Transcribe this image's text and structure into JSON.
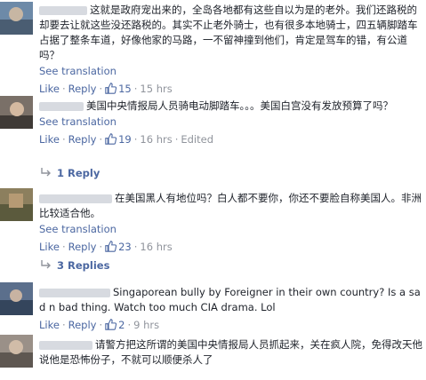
{
  "colors": {
    "link": "#4b67a1",
    "meta": "#90949c",
    "text": "#1d2129"
  },
  "comments": [
    {
      "text": "这就是政府宠出来的，全岛各地都有这些自以为是的老外。我们还路税的却要去让就这些没还路税的。其实不止老外骑士，也有很多本地骑士，四五辆脚踏车占据了整条车道，好像他家的马路，一不留神撞到他们，肯定是驾车的错，有公道吗？",
      "see_translation": "See translation",
      "like": "Like",
      "reply": "Reply",
      "like_count": "15",
      "time": "15 hrs",
      "edited": ""
    },
    {
      "text": "美国中央情报局人员骑电动脚踏车。。。美国白宫没有发放预算了吗？",
      "see_translation": "See translation",
      "like": "Like",
      "reply": "Reply",
      "like_count": "19",
      "time": "16 hrs",
      "edited": "Edited"
    },
    {
      "text": "在美国黑人有地位吗？白人都不要你，你还不要脸自称美国人。非洲比较适合他。",
      "see_translation": "See translation",
      "like": "Like",
      "reply": "Reply",
      "like_count": "23",
      "time": "16 hrs",
      "edited": ""
    },
    {
      "text": "Singaporean bully by Foreigner in their own country? Is a sad n bad thing. Watch too much CIA drama. Lol",
      "like": "Like",
      "reply": "Reply",
      "like_count": "2",
      "time": "9 hrs",
      "edited": ""
    },
    {
      "text": "请警方把这所谓的美国中央情报局人员抓起来，关在疯人院，免得改天他说他是恐怖份子，不就可以顺便杀人了"
    }
  ],
  "reply_links": [
    "1 Reply",
    "3 Replies"
  ]
}
